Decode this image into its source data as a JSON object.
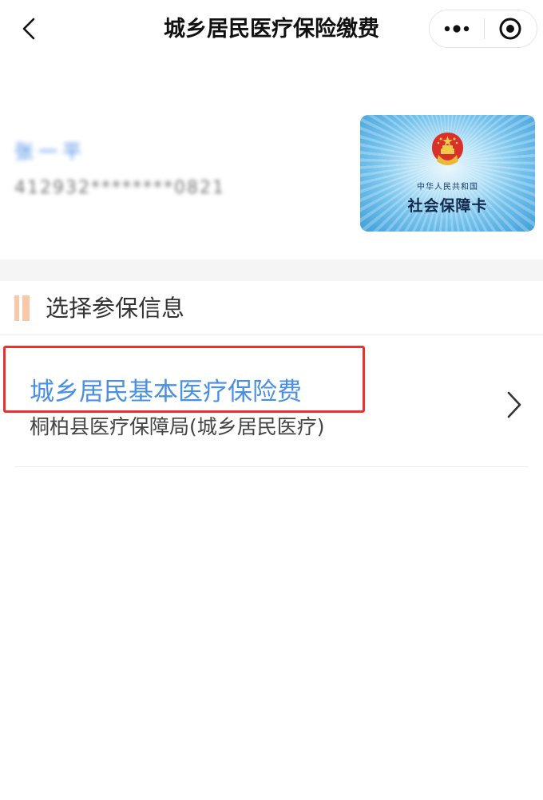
{
  "nav": {
    "title": "城乡居民医疗保险缴费",
    "back_icon": "chevron-left-icon",
    "more_icon": "more-dots-icon",
    "close_icon": "target-circle-icon"
  },
  "user": {
    "name": "张一平",
    "id_masked": "412932********0821"
  },
  "card": {
    "subtitle": "中华人民共和国",
    "title": "社会保障卡",
    "emblem_icon": "national-emblem-icon"
  },
  "section": {
    "title": "选择参保信息"
  },
  "items": [
    {
      "title": "城乡居民基本医疗保险费",
      "subtitle": "桐柏县医疗保障局(城乡居民医疗)"
    }
  ],
  "colors": {
    "accent_blue": "#4a90e2",
    "highlight_red": "#e8322e",
    "section_marker": "#f7c9a8"
  }
}
